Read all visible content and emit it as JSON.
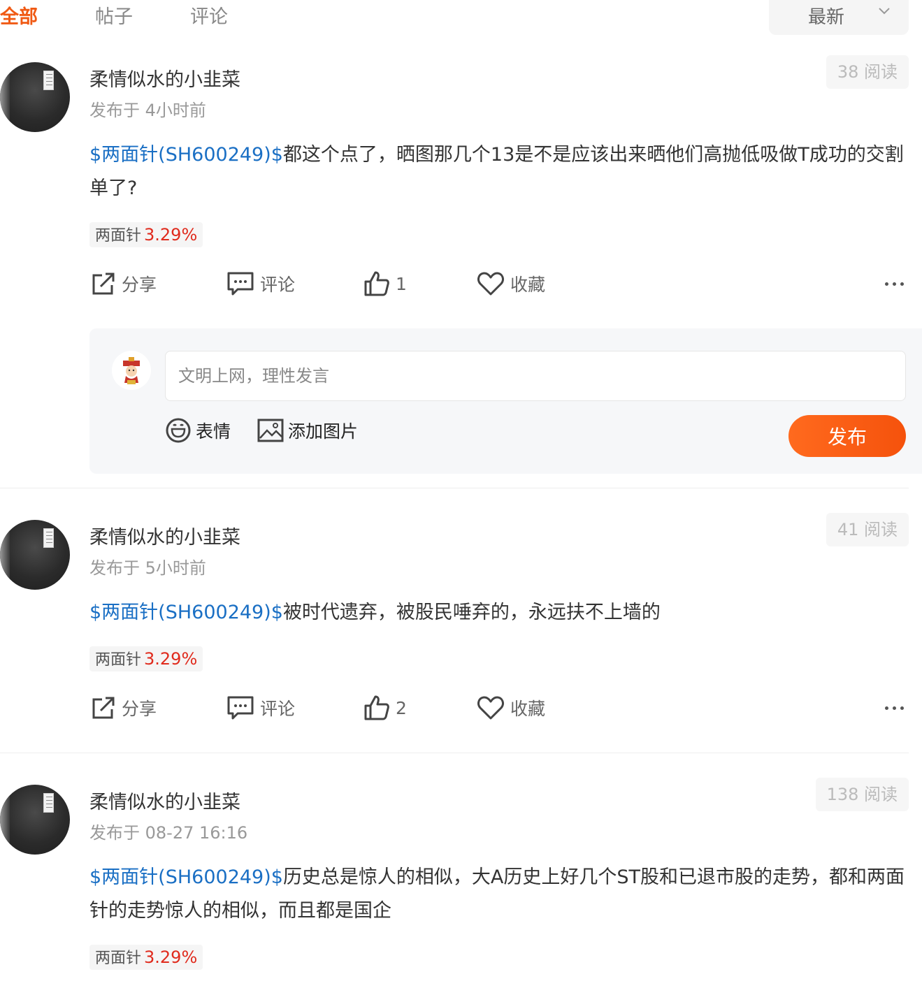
{
  "tabs": [
    {
      "label": "全部",
      "active": true
    },
    {
      "label": "帖子",
      "active": false
    },
    {
      "label": "评论",
      "active": false
    }
  ],
  "sort": {
    "label": "最新",
    "icon": "chevron-down-icon"
  },
  "posts": [
    {
      "author": "柔情似水的小韭菜",
      "time": "发布于 4小时前",
      "reads": "38 阅读",
      "stock_link": "$两面针(SH600249)$",
      "text": "都这个点了，晒图那几个13是不是应该出来晒他们高抛低吸做T成功的交割单了?",
      "tag_name": "两面针",
      "tag_change": "3.29%",
      "actions": {
        "share": "分享",
        "comment": "评论",
        "like_count": "1",
        "favorite": "收藏"
      }
    },
    {
      "author": "柔情似水的小韭菜",
      "time": "发布于 5小时前",
      "reads": "41 阅读",
      "stock_link": "$两面针(SH600249)$",
      "text": "被时代遗弃，被股民唾弃的，永远扶不上墙的",
      "tag_name": "两面针",
      "tag_change": "3.29%",
      "actions": {
        "share": "分享",
        "comment": "评论",
        "like_count": "2",
        "favorite": "收藏"
      }
    },
    {
      "author": "柔情似水的小韭菜",
      "time": "发布于 08-27 16:16",
      "reads": "138 阅读",
      "stock_link": "$两面针(SH600249)$",
      "text": "历史总是惊人的相似，大A历史上好几个ST股和已退市股的走势，都和两面针的走势惊人的相似，而且都是国企",
      "tag_name": "两面针",
      "tag_change": "3.29%"
    }
  ],
  "comment_box": {
    "placeholder": "文明上网，理性发言",
    "emoji_label": "表情",
    "image_label": "添加图片",
    "publish_label": "发布"
  },
  "colors": {
    "accent": "#f05a14",
    "link": "#1a6fc4",
    "up": "#e02b1d"
  }
}
